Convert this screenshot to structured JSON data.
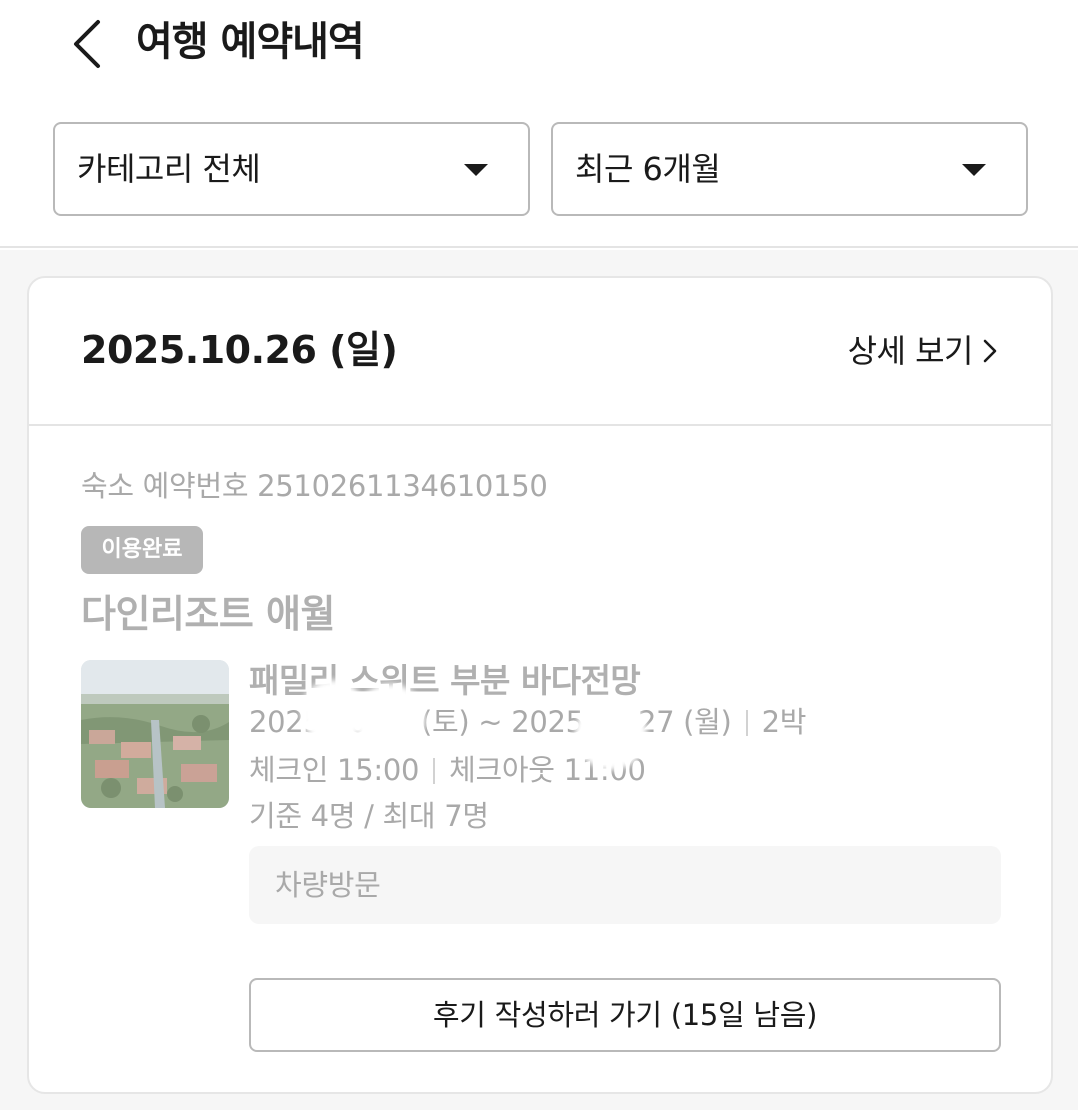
{
  "header": {
    "title": "여행 예약내역",
    "back_icon": "chevron-left-icon"
  },
  "filters": {
    "category": "카테고리 전체",
    "period": "최근 6개월",
    "caret_icon": "caret-down-icon"
  },
  "booking": {
    "date": "2025.10.26 (일)",
    "detail_label": "상세 보기",
    "detail_icon": "chevron-right-icon",
    "booking_number": "숙소 예약번호 2510261134610150",
    "status": "이용완료",
    "hotel_name": "다인리조트 애월",
    "room_name": "패밀리 스위트 부분 바다전망",
    "stay_dates": "2025.10.25 (토) ~ 2025.10.27 (월)",
    "nights": "2박",
    "checkin": "체크인 15:00",
    "checkout": "체크아웃 11:00",
    "capacity": "기준 4명 / 최대 7명",
    "visit_method": "차량방문",
    "review_button": "후기 작성하러 가기 (15일 남음)"
  },
  "colors": {
    "primary_text": "#1a1a1a",
    "muted_text": "#a9a9a9",
    "badge_bg": "#b7b7b7",
    "border": "#b9b9b9",
    "page_bg": "#f6f6f6"
  }
}
